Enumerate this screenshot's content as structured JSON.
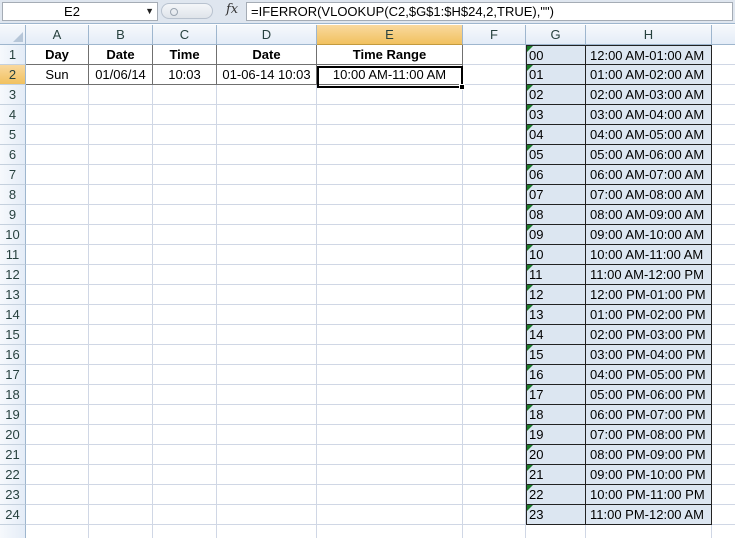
{
  "formula_bar": {
    "name_box": "E2",
    "fx_label": "fx",
    "formula": "=IFERROR(VLOOKUP(C2,$G$1:$H$24,2,TRUE),\"\")"
  },
  "columns": [
    "A",
    "B",
    "C",
    "D",
    "E",
    "F",
    "G",
    "H"
  ],
  "active_column": "E",
  "rows": [
    "1",
    "2",
    "3",
    "4",
    "5",
    "6",
    "7",
    "8",
    "9",
    "10",
    "11",
    "12",
    "13",
    "14",
    "15",
    "16",
    "17",
    "18",
    "19",
    "20",
    "21",
    "22",
    "23",
    "24"
  ],
  "active_row": "2",
  "table": {
    "headers": [
      "Day",
      "Date",
      "Time",
      "Date",
      "Time Range"
    ],
    "row": [
      "Sun",
      "01/06/14",
      "10:03",
      "01-06-14 10:03",
      "10:00 AM-11:00 AM"
    ]
  },
  "lookup": [
    {
      "g": "00",
      "h": "12:00 AM-01:00 AM"
    },
    {
      "g": "01",
      "h": "01:00 AM-02:00 AM"
    },
    {
      "g": "02",
      "h": "02:00 AM-03:00 AM"
    },
    {
      "g": "03",
      "h": "03:00 AM-04:00 AM"
    },
    {
      "g": "04",
      "h": "04:00 AM-05:00 AM"
    },
    {
      "g": "05",
      "h": "05:00 AM-06:00 AM"
    },
    {
      "g": "06",
      "h": "06:00 AM-07:00 AM"
    },
    {
      "g": "07",
      "h": "07:00 AM-08:00 AM"
    },
    {
      "g": "08",
      "h": "08:00 AM-09:00 AM"
    },
    {
      "g": "09",
      "h": "09:00 AM-10:00 AM"
    },
    {
      "g": "10",
      "h": "10:00 AM-11:00 AM"
    },
    {
      "g": "11",
      "h": "11:00 AM-12:00 PM"
    },
    {
      "g": "12",
      "h": "12:00 PM-01:00 PM"
    },
    {
      "g": "13",
      "h": "01:00 PM-02:00 PM"
    },
    {
      "g": "14",
      "h": "02:00 PM-03:00 PM"
    },
    {
      "g": "15",
      "h": "03:00 PM-04:00 PM"
    },
    {
      "g": "16",
      "h": "04:00 PM-05:00 PM"
    },
    {
      "g": "17",
      "h": "05:00 PM-06:00 PM"
    },
    {
      "g": "18",
      "h": "06:00 PM-07:00 PM"
    },
    {
      "g": "19",
      "h": "07:00 PM-08:00 PM"
    },
    {
      "g": "20",
      "h": "08:00 PM-09:00 PM"
    },
    {
      "g": "21",
      "h": "09:00 PM-10:00 PM"
    },
    {
      "g": "22",
      "h": "10:00 PM-11:00 PM"
    },
    {
      "g": "23",
      "h": "11:00 PM-12:00 AM"
    }
  ],
  "colors": {
    "lookup_fill": "#dce6f1",
    "error_indicator": "#1a7a28",
    "active_header": "#f1c15f"
  },
  "icons": {
    "name_box_dropdown": "chevron-down-icon",
    "function": "fx-icon"
  }
}
